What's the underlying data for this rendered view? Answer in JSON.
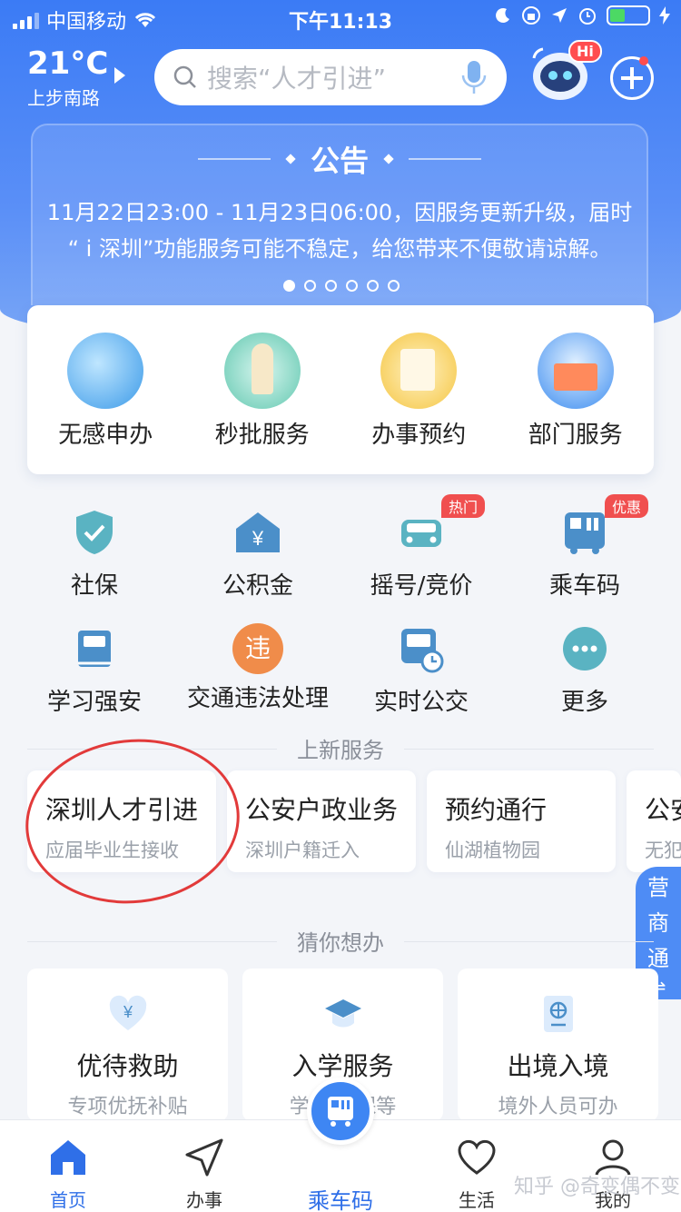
{
  "status": {
    "carrier": "中国移动",
    "time": "下午11:13"
  },
  "header": {
    "temperature": "21°C",
    "location": "上步南路",
    "search_placeholder": "搜索“人才引进”",
    "hi_badge": "Hi"
  },
  "notice": {
    "title": "公告",
    "line1": "11月22日23:00 - 11月23日06:00，因服务更新升级，届时",
    "line2": "“ i 深圳”功能服务可能不稳定，给您带来不便敬请谅解。",
    "dot_count": 6,
    "active_dot": 0
  },
  "features": [
    {
      "label": "无感申办",
      "icon": "robot-service-icon"
    },
    {
      "label": "秒批服务",
      "icon": "rocket-icon"
    },
    {
      "label": "办事预约",
      "icon": "notepad-pencil-icon"
    },
    {
      "label": "部门服务",
      "icon": "building-icon"
    }
  ],
  "services_row1": [
    {
      "label": "社保",
      "icon": "shield-check-icon",
      "tag": ""
    },
    {
      "label": "公积金",
      "icon": "house-yen-icon",
      "tag": ""
    },
    {
      "label": "摇号/竞价",
      "icon": "car-icon",
      "tag": "热门"
    },
    {
      "label": "乘车码",
      "icon": "bus-code-icon",
      "tag": "优惠"
    }
  ],
  "services_row2": [
    {
      "label": "学习强安",
      "icon": "book-icon"
    },
    {
      "label": "交通违法处理",
      "icon": "violation-icon",
      "icon_text": "违"
    },
    {
      "label": "实时公交",
      "icon": "bus-clock-icon"
    },
    {
      "label": "更多",
      "icon": "more-dots-icon"
    }
  ],
  "new_services": {
    "title": "上新服务",
    "items": [
      {
        "title": "深圳人才引进",
        "sub": "应届毕业生接收"
      },
      {
        "title": "公安户政业务",
        "sub": "深圳户籍迁入"
      },
      {
        "title": "预约通行",
        "sub": "仙湖植物园"
      },
      {
        "title": "公安",
        "sub": "无犯"
      }
    ]
  },
  "side_tab": [
    "营",
    "商",
    "通"
  ],
  "guess": {
    "title": "猜你想办",
    "items": [
      {
        "title": "优待救助",
        "sub": "专项优抚补贴",
        "icon": "heart-yen-icon"
      },
      {
        "title": "入学服务",
        "sub": "学位/医保等",
        "icon": "graduation-cap-icon"
      },
      {
        "title": "出境入境",
        "sub": "境外人员可办",
        "icon": "passport-icon"
      }
    ]
  },
  "tabbar": {
    "items": [
      "首页",
      "办事",
      "乘车码",
      "生活",
      "我的"
    ],
    "active": "首页"
  },
  "watermark": "知乎 @奇变偶不变",
  "colors": {
    "primary": "#3b7bf5",
    "accent_red": "#f04f4f",
    "teal_icon": "#5ab3c2"
  }
}
